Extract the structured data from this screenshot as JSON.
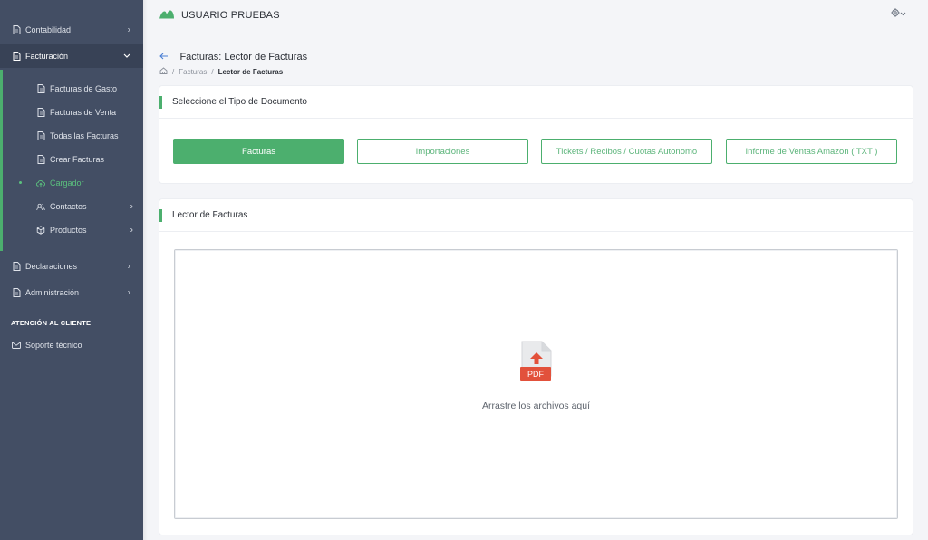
{
  "sidebar": {
    "contabilidad": "Contabilidad",
    "facturacion": "Facturación",
    "sub": {
      "gasto": "Facturas de Gasto",
      "venta": "Facturas de Venta",
      "todas": "Todas las Facturas",
      "crear": "Crear Facturas",
      "cargador": "Cargador",
      "contactos": "Contactos",
      "productos": "Productos"
    },
    "declaraciones": "Declaraciones",
    "administracion": "Administración",
    "heading": "ATENCIÓN AL CLIENTE",
    "soporte": "Soporte técnico"
  },
  "topbar": {
    "user": "USUARIO PRUEBAS"
  },
  "page": {
    "title": "Facturas: Lector de Facturas",
    "breadcrumb": [
      "Facturas",
      "Lector de Facturas"
    ]
  },
  "doc_type": {
    "title": "Seleccione el Tipo de Documento",
    "buttons": [
      "Facturas",
      "Importaciones",
      "Tickets / Recibos / Cuotas Autonomo",
      "Informe de Ventas Amazon ( TXT )"
    ],
    "selected": "Facturas"
  },
  "reader": {
    "title": "Lector de Facturas",
    "drop_text": "Arrastre los archivos aquí",
    "file_badge": "PDF"
  },
  "colors": {
    "accent": "#4caf6e",
    "sidebar": "#434e64",
    "pdf": "#e2513b"
  }
}
